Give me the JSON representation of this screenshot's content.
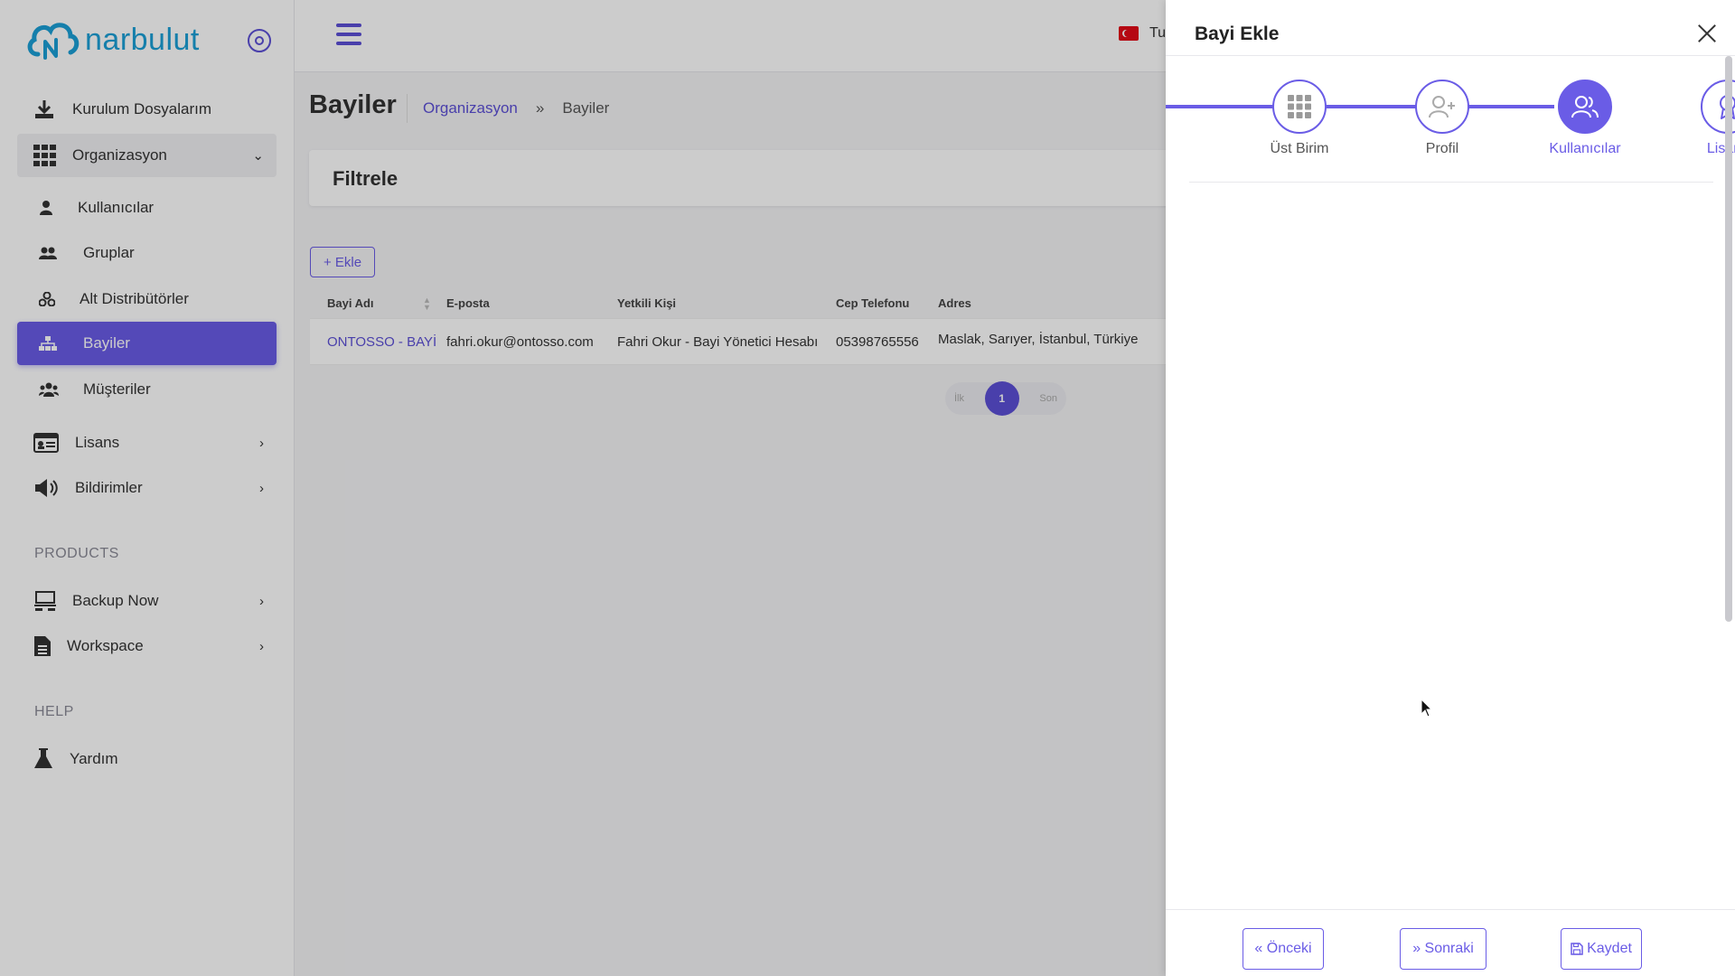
{
  "brand": {
    "name": "narbulut"
  },
  "sidebar": {
    "items": [
      {
        "label": "Kurulum Dosyalarım"
      },
      {
        "label": "Organizasyon"
      },
      {
        "label": "Kullanıcılar"
      },
      {
        "label": "Gruplar"
      },
      {
        "label": "Alt Distribütörler"
      },
      {
        "label": "Bayiler"
      },
      {
        "label": "Müşteriler"
      },
      {
        "label": "Lisans"
      },
      {
        "label": "Bildirimler"
      },
      {
        "label": "Backup Now"
      },
      {
        "label": "Workspace"
      },
      {
        "label": "Yardım"
      }
    ],
    "sections": {
      "products": "PRODUCTS",
      "help": "HELP"
    }
  },
  "topbar": {
    "language": "Tu"
  },
  "main": {
    "title": "Bayiler",
    "breadcrumb": {
      "parent": "Organizasyon",
      "separator": "»",
      "current": "Bayiler"
    },
    "filter_title": "Filtrele",
    "add_button": "+ Ekle",
    "table": {
      "headers": [
        "Bayi Adı",
        "E-posta",
        "Yetkili Kişi",
        "Cep Telefonu",
        "Adres"
      ],
      "rows": [
        [
          "ONTOSSO - BAYİ",
          "fahri.okur@ontosso.com",
          "Fahri Okur - Bayi Yönetici Hesabı",
          "05398765556",
          "Maslak, Sarıyer, İstanbul, Türkiye"
        ]
      ]
    },
    "pagination": {
      "first": "İlk",
      "page": "1",
      "last": "Son"
    }
  },
  "drawer": {
    "title": "Bayi Ekle",
    "steps": [
      {
        "label": "Üst Birim",
        "state": "done"
      },
      {
        "label": "Profil",
        "state": "done"
      },
      {
        "label": "Kullanıcılar",
        "state": "active"
      },
      {
        "label": "Lisans",
        "state": "future"
      }
    ],
    "buttons": {
      "prev": "« Önceki",
      "next": "» Sonraki",
      "save": "Kaydet"
    }
  },
  "colors": {
    "accent": "#6a5ce6",
    "brand_blue": "#1b9fd6"
  }
}
